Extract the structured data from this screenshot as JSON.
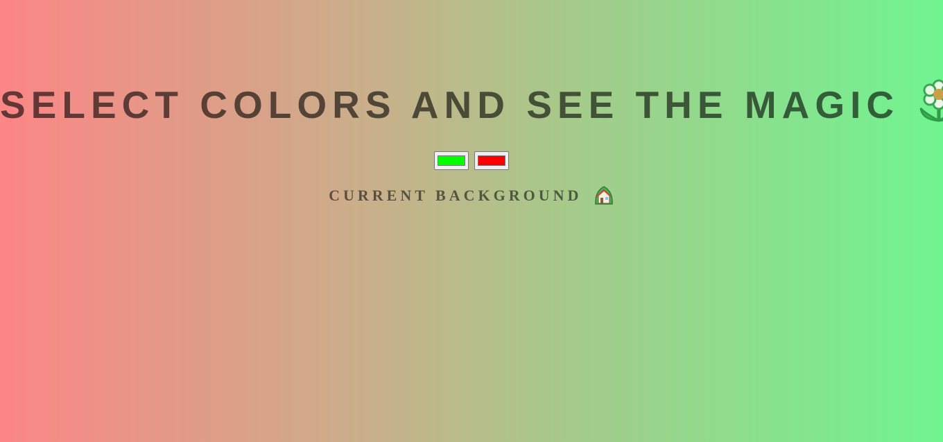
{
  "heading": {
    "text": "SELECT COLORS AND SEE THE MAGIC",
    "icon": "flower-icon"
  },
  "color_pickers": [
    {
      "label": "color-1",
      "value": "#00ff00"
    },
    {
      "label": "color-2",
      "value": "#ff0000"
    }
  ],
  "current_background": {
    "text": "CURRENT BACKGROUND",
    "icon": "house-icon"
  },
  "colors": {
    "gradient_left": "#fb8686",
    "gradient_right": "#70f490"
  }
}
